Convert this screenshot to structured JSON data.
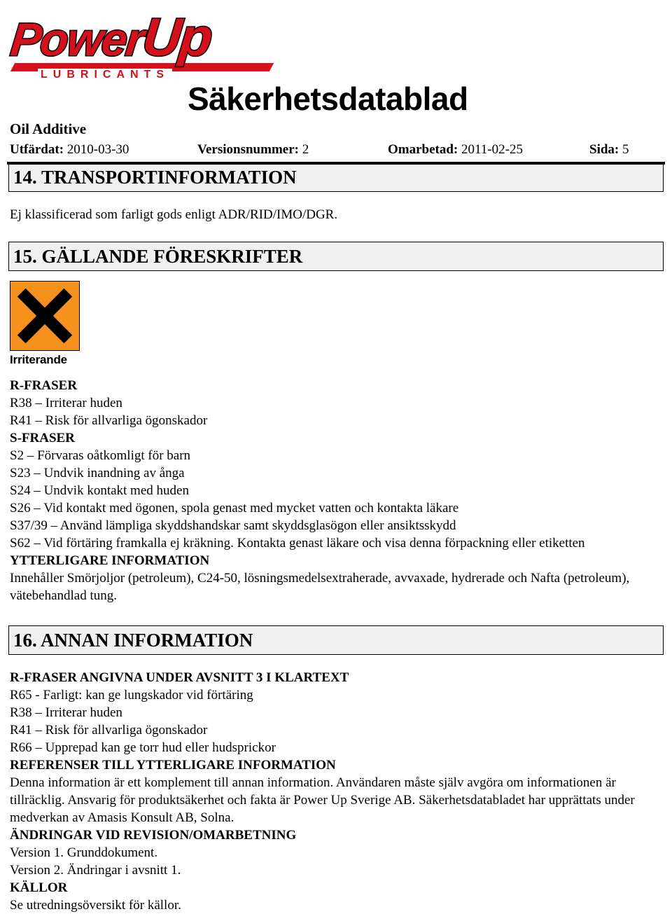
{
  "header": {
    "logo": {
      "word_main": "Power",
      "word_accent": "Up",
      "subtitle": "LUBRICANTS",
      "brand_color": "#d3101b"
    },
    "doc_title": "Säkerhetsdatablad",
    "product_name": "Oil Additive",
    "meta": {
      "issued_label": "Utfärdat:",
      "issued_value": "2010-03-30",
      "version_label": "Versionsnummer:",
      "version_value": "2",
      "revised_label": "Omarbetad:",
      "revised_value": "2011-02-25",
      "page_label": "Sida:",
      "page_value": "5"
    }
  },
  "sections": {
    "s14": {
      "heading": "14. TRANSPORTINFORMATION",
      "body": "Ej klassificerad som farligt gods enligt ADR/RID/IMO/DGR."
    },
    "s15": {
      "heading": "15. GÄLLANDE FÖRESKRIFTER",
      "pictogram": {
        "name": "irritant-pictogram",
        "label": "Irriterande",
        "bg_color": "#f5921e",
        "symbol_color": "#000000"
      },
      "r_heading": "R-FRASER",
      "r_phrases": [
        "R38 – Irriterar huden",
        "R41 – Risk för allvarliga ögonskador"
      ],
      "s_heading": "S-FRASER",
      "s_phrases": [
        "S2 – Förvaras oåtkomligt för barn",
        "S23 – Undvik inandning av ånga",
        "S24 – Undvik kontakt med huden",
        "S26 – Vid kontakt med ögonen, spola genast med mycket vatten och kontakta läkare",
        "S37/39 – Använd lämpliga skyddshandskar samt skyddsglasögon eller ansiktsskydd",
        "S62 – Vid förtäring framkalla ej kräkning. Kontakta genast läkare och visa denna förpackning eller etiketten"
      ],
      "extra_heading": "YTTERLIGARE INFORMATION",
      "extra_body": "Innehåller Smörjoljor (petroleum), C24-50, lösningsmedelsextraherade, avvaxade, hydrerade och Nafta (petroleum), vätebehandlad tung."
    },
    "s16": {
      "heading": "16. ANNAN INFORMATION",
      "r_clear_heading": "R-FRASER ANGIVNA UNDER AVSNITT 3 I KLARTEXT",
      "r_clear_phrases": [
        "R65 - Farligt: kan ge lungskador vid förtäring",
        "R38 – Irriterar huden",
        "R41 – Risk för allvarliga ögonskador",
        "R66 – Upprepad kan ge torr hud eller hudsprickor"
      ],
      "references_heading": "REFERENSER TILL YTTERLIGARE INFORMATION",
      "references_body": "Denna information är ett komplement till annan information. Användaren måste själv avgöra om informationen är tillräcklig. Ansvarig för produktsäkerhet och fakta är Power Up Sverige AB. Säkerhetsdatabladet har upprättats under medverkan av Amasis Konsult AB, Solna.",
      "changes_heading": "ÄNDRINGAR VID REVISION/OMARBETNING",
      "changes_lines": [
        "Version 1. Grunddokument.",
        "Version 2. Ändringar i avsnitt 1."
      ],
      "sources_heading": "KÄLLOR",
      "sources_body": "Se utredningsöversikt för källor."
    }
  }
}
